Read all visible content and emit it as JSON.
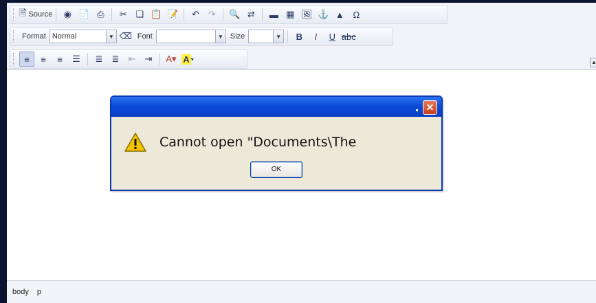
{
  "toolbar": {
    "source_label": "Source",
    "format_label": "Format",
    "format_value": "Normal",
    "font_label": "Font",
    "font_value": "",
    "size_label": "Size",
    "size_value": ""
  },
  "dialog": {
    "message": "Cannot open \"Documents\\The",
    "ok_label": "OK"
  },
  "statusbar": {
    "path": [
      "body",
      "p"
    ]
  },
  "colors": {
    "dialog_title": "#0a4bd8",
    "dialog_body": "#ece9d8",
    "close_button": "#d2492a",
    "page_background": "#0b1430"
  }
}
